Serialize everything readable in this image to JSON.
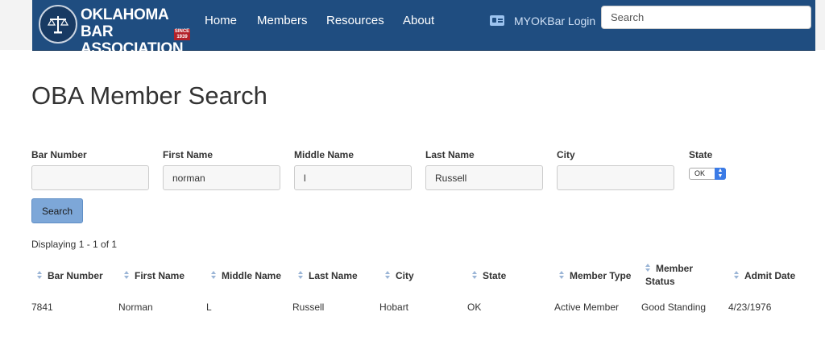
{
  "header": {
    "logo_line1": "OKLAHOMA BAR",
    "logo_line2": "ASSOCIATION",
    "logo_since": "SINCE 1939",
    "nav": [
      "Home",
      "Members",
      "Resources",
      "About"
    ],
    "login_label": "MYOKBar Login",
    "search_placeholder": "Search"
  },
  "page": {
    "title": "OBA Member Search"
  },
  "form": {
    "fields": [
      {
        "label": "Bar Number",
        "value": ""
      },
      {
        "label": "First Name",
        "value": "norman"
      },
      {
        "label": "Middle Name",
        "value": "l"
      },
      {
        "label": "Last Name",
        "value": "Russell"
      },
      {
        "label": "City",
        "value": ""
      }
    ],
    "state_label": "State",
    "state_value": "OK",
    "search_button": "Search"
  },
  "results": {
    "summary": "Displaying 1 - 1 of 1",
    "columns": [
      "Bar Number",
      "First Name",
      "Middle Name",
      "Last Name",
      "City",
      "State",
      "Member Type",
      "Member Status",
      "Admit Date"
    ],
    "rows": [
      [
        "7841",
        "Norman",
        "L",
        "Russell",
        "Hobart",
        "OK",
        "Active Member",
        "Good Standing",
        "4/23/1976"
      ]
    ]
  },
  "colors": {
    "navbar": "#1f4d80",
    "button": "#7da7d8",
    "sort_icon": "#9bb5d6"
  }
}
